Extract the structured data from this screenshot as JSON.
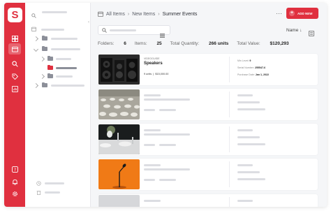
{
  "app": {
    "logo_letter": "S"
  },
  "breadcrumb": {
    "items": [
      "All Items",
      "New Items",
      "Summer Events"
    ]
  },
  "actions": {
    "more": "···",
    "add_new": "ADD NEW"
  },
  "toolbar": {
    "sort_label": "Name ↓"
  },
  "stats": {
    "folders_label": "Folders:",
    "folders_value": "6",
    "items_label": "Items:",
    "items_value": "25",
    "quantity_label": "Total Quantity:",
    "quantity_value": "266 units",
    "value_label": "Total Value:",
    "value_value": "$120,293"
  },
  "items": [
    {
      "category": "VIDEOGUIDE",
      "name": "Speakers",
      "quantity": "9 units",
      "price": "$15,000.00",
      "fields": [
        {
          "label": "Min Level:",
          "value": "9"
        },
        {
          "label": "Serial Number:",
          "value": "255547-6"
        },
        {
          "label": "Purchase Date:",
          "value": "Jan 1, 2022"
        }
      ]
    }
  ],
  "colors": {
    "accent": "#e0303f",
    "background": "#f5f6f8"
  },
  "icons": [
    "dashboard-icon",
    "items-icon",
    "search-icon",
    "tag-icon",
    "reports-icon",
    "help-icon",
    "bell-icon",
    "settings-icon"
  ]
}
